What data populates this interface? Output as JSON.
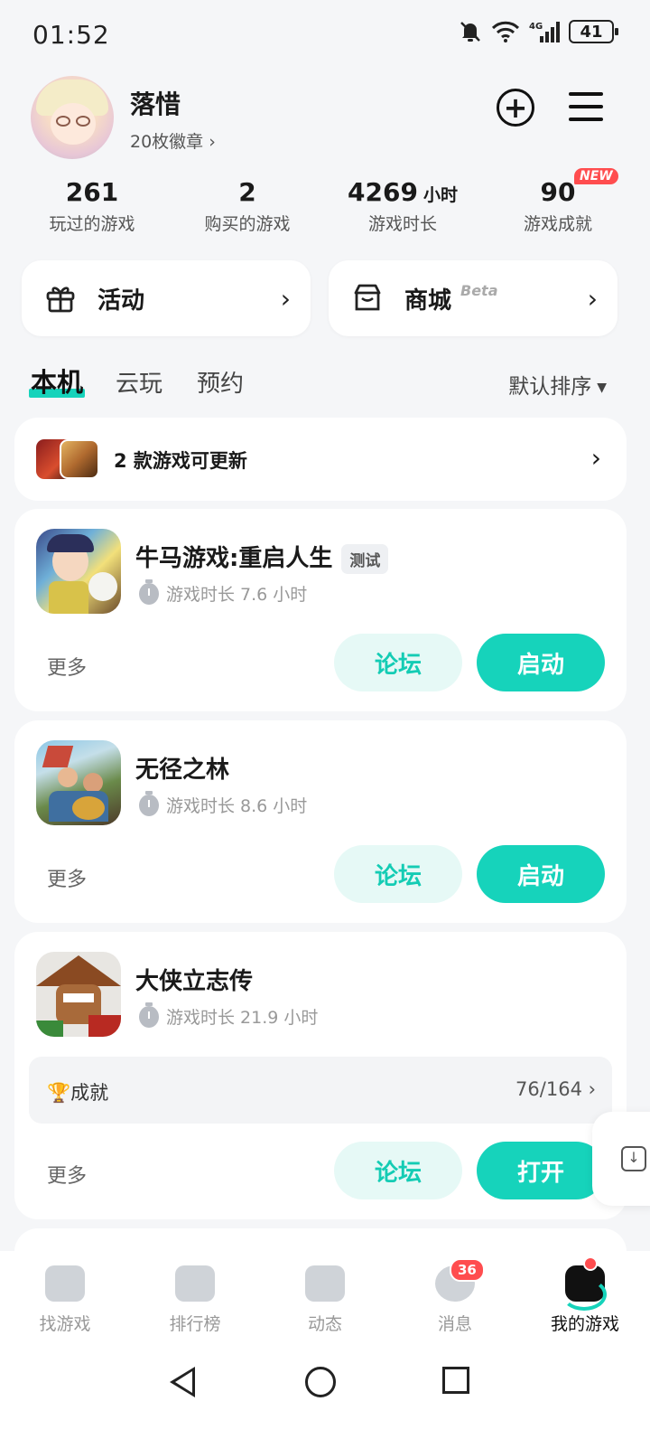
{
  "status": {
    "time": "01:52",
    "battery": "41",
    "network": "4G"
  },
  "profile": {
    "name": "落惜",
    "badges": "20枚徽章 ›"
  },
  "stats": [
    {
      "num": "261",
      "unit": "",
      "label": "玩过的游戏"
    },
    {
      "num": "2",
      "unit": "",
      "label": "购买的游戏"
    },
    {
      "num": "4269",
      "unit": "小时",
      "label": "游戏时长"
    },
    {
      "num": "90",
      "unit": "",
      "label": "游戏成就",
      "tag": "NEW"
    }
  ],
  "quick": {
    "activity": "活动",
    "mall": "商城",
    "mall_tag": "Beta"
  },
  "tabs": {
    "local": "本机",
    "cloud": "云玩",
    "reserve": "预约",
    "sort": "默认排序"
  },
  "update": {
    "text": "2 款游戏可更新"
  },
  "games": [
    {
      "name": "牛马游戏:重启人生",
      "tag": "测试",
      "time": "游戏时长 7.6 小时",
      "more": "更多",
      "forum": "论坛",
      "action": "启动"
    },
    {
      "name": "无径之林",
      "tag": "",
      "time": "游戏时长 8.6 小时",
      "more": "更多",
      "forum": "论坛",
      "action": "启动"
    },
    {
      "name": "大侠立志传",
      "tag": "",
      "time": "游戏时长 21.9 小时",
      "more": "更多",
      "forum": "论坛",
      "action": "打开",
      "achievement": {
        "label": "🏆成就",
        "progress": "76/164 ›"
      }
    }
  ],
  "nav": [
    {
      "label": "找游戏"
    },
    {
      "label": "排行榜"
    },
    {
      "label": "动态"
    },
    {
      "label": "消息",
      "badge": "36"
    },
    {
      "label": "我的游戏"
    }
  ],
  "colors": {
    "accent": "#16d3bb",
    "accent_light": "#e6f9f6",
    "badge": "#ff4d4f"
  }
}
